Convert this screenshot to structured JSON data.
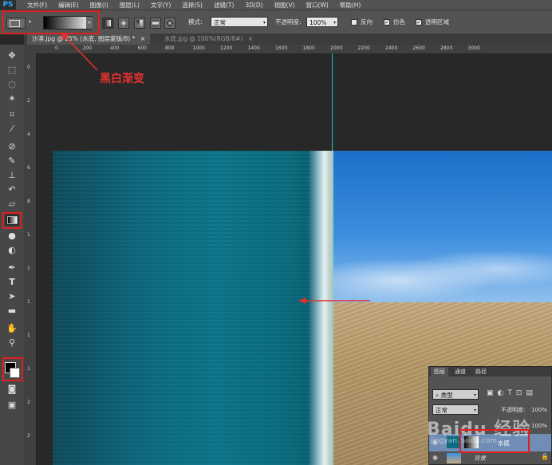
{
  "menubar": {
    "logo": "PS",
    "items": [
      "文件(F)",
      "编辑(E)",
      "图像(I)",
      "图层(L)",
      "文字(Y)",
      "选择(S)",
      "滤镜(T)",
      "3D(D)",
      "视图(V)",
      "窗口(W)",
      "帮助(H)"
    ]
  },
  "options": {
    "mode_label": "模式:",
    "mode_value": "正常",
    "opacity_label": "不透明度:",
    "opacity_value": "100%",
    "reverse_label": "反向",
    "dither_label": "仿色",
    "transparency_label": "透明区域",
    "reverse_checked": false,
    "dither_checked": true,
    "transparency_checked": true
  },
  "doc_tabs": [
    {
      "label": "沙漠.jpg @ 25% (水底, 图层蒙版/8) *",
      "close": "×"
    },
    {
      "label": "水底.jpg @ 100%(RGB/8#)",
      "close": "×"
    }
  ],
  "ruler_top": [
    "0",
    "200",
    "400",
    "600",
    "800",
    "1000",
    "1200",
    "1400",
    "1600",
    "1800",
    "2000",
    "2200",
    "2400",
    "2600",
    "2800",
    "3000"
  ],
  "ruler_left": [
    "0",
    "2",
    "4",
    "6",
    "8",
    "1",
    "1",
    "1",
    "1",
    "1",
    "2",
    "2"
  ],
  "annotation": {
    "label": "黑白渐变",
    "color": "#e53030"
  },
  "layers": {
    "tabs": [
      "图层",
      "通道",
      "路径"
    ],
    "filter_value": "类型",
    "blend_value": "正常",
    "opacity_label": "不透明度:",
    "opacity_value": "100%",
    "fill_value": "100%",
    "layer_name": "水底",
    "background_name": "背景"
  },
  "watermark": {
    "text": "Baidu 经验",
    "sub": "jingyan.baidu.com"
  },
  "colors": {
    "accent": "#e02020",
    "guide": "#2ee3e3",
    "panel": "#535353"
  }
}
